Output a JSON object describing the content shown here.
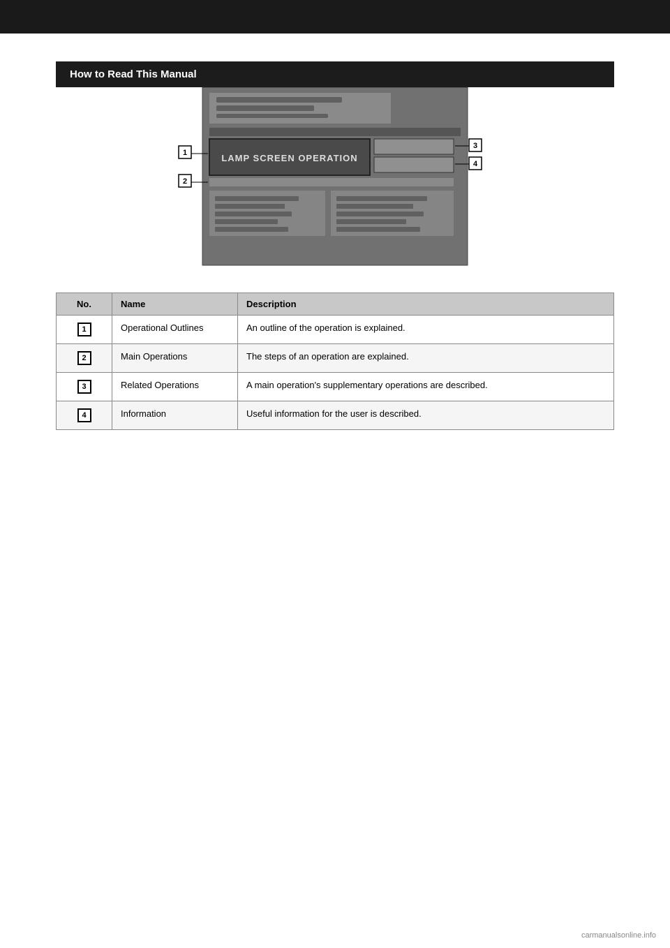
{
  "page": {
    "background": "#ffffff"
  },
  "section": {
    "title": "How to Read This Manual"
  },
  "diagram": {
    "label1": "1",
    "label2": "2",
    "label3": "3",
    "label4": "4",
    "main_op_text": "LAMP SCREEN OPERATION"
  },
  "table": {
    "headers": {
      "no": "No.",
      "name": "Name",
      "description": "Description"
    },
    "rows": [
      {
        "no": "1",
        "name": "Operational Outlines",
        "description": "An outline of the operation is explained."
      },
      {
        "no": "2",
        "name": "Main Operations",
        "description": "The steps of an operation are explained."
      },
      {
        "no": "3",
        "name": "Related Operations",
        "description": "A main operation's supplementary operations are described."
      },
      {
        "no": "4",
        "name": "Information",
        "description": "Useful information for the user is described."
      }
    ]
  },
  "footer": {
    "watermark": "carmanualsonline.info"
  }
}
